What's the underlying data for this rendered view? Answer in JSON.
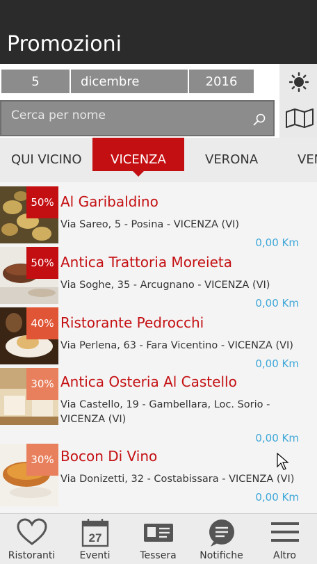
{
  "header": {
    "title": "Promozioni"
  },
  "date": {
    "day": "5",
    "month": "dicembre",
    "year": "2016"
  },
  "search": {
    "placeholder": "Cerca per nome"
  },
  "tabs": [
    "QUI VICINO",
    "VICENZA",
    "VERONA",
    "VEN"
  ],
  "restaurants": [
    {
      "name": "Al Garibaldino",
      "address": "Via Sareo, 5 -  Posina - VICENZA (VI)",
      "discount": "50%",
      "distance": "0,00 Km",
      "badge_color": "#c40f12"
    },
    {
      "name": "Antica Trattoria Moreieta",
      "address": "Via Soghe, 35 -  Arcugnano - VICENZA (VI)",
      "discount": "50%",
      "distance": "0,00 Km",
      "badge_color": "#c40f12"
    },
    {
      "name": "Ristorante Pedrocchi",
      "address": "Via Perlena, 63 -  Fara Vicentino - VICENZA (VI)",
      "discount": "40%",
      "distance": "0,00 Km",
      "badge_color": "#e05535"
    },
    {
      "name": "Antica Osteria Al Castello",
      "address": "Via Castello, 19 -  Gambellara, Loc. Sorio - VICENZA (VI)",
      "discount": "30%",
      "distance": "0,00 Km",
      "badge_color": "#e8805d"
    },
    {
      "name": "Bocon Di Vino",
      "address": "Via Donizetti, 32 -  Costabissara - VICENZA (VI)",
      "discount": "30%",
      "distance": "0,00 Km",
      "badge_color": "#e8805d"
    }
  ],
  "bottom_nav": [
    {
      "label": "Ristoranti",
      "icon": "heart-icon"
    },
    {
      "label": "Eventi",
      "icon": "calendar-icon",
      "calendar_day": "27"
    },
    {
      "label": "Tessera",
      "icon": "card-icon"
    },
    {
      "label": "Notifiche",
      "icon": "message-icon"
    },
    {
      "label": "Altro",
      "icon": "menu-icon"
    }
  ]
}
